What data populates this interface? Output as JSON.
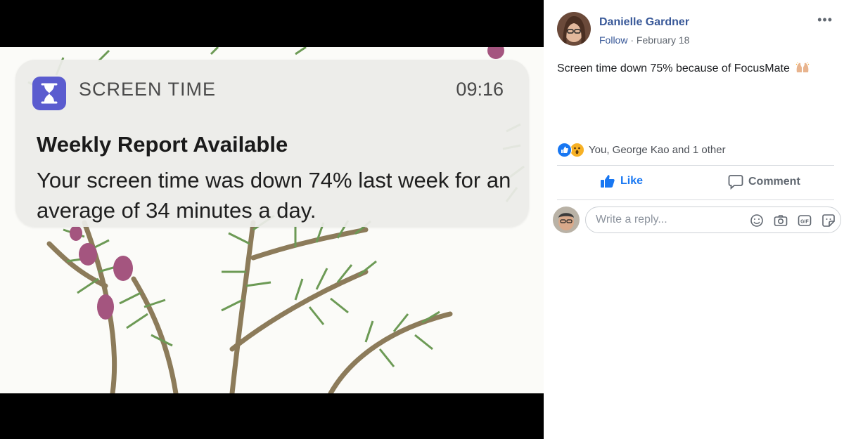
{
  "photo": {
    "notification": {
      "app_name": "SCREEN TIME",
      "time": "09:16",
      "title": "Weekly Report Available",
      "body": "Your screen time was down 74% last week for an average of 34 minutes a day.",
      "app_icon": "hourglass-icon",
      "icon_color": "#5b5ccf"
    }
  },
  "post": {
    "author": "Danielle Gardner",
    "follow": "Follow",
    "separator": " · ",
    "date": "February 18",
    "more_icon": "ellipsis-icon",
    "text": "Screen time down 75% because of FocusMate",
    "text_emoji": "raised-hands-emoji",
    "reactions": {
      "icons": [
        "like-reaction-icon",
        "wow-reaction-icon"
      ],
      "summary": "You, George Kao and 1 other"
    },
    "actions": {
      "like": "Like",
      "comment": "Comment"
    },
    "reply": {
      "placeholder": "Write a reply...",
      "icons": [
        "emoji-icon",
        "camera-icon",
        "gif-icon",
        "sticker-icon"
      ]
    }
  },
  "colors": {
    "link": "#385898",
    "like_blue": "#1877f2",
    "wow_yellow": "#f7b125"
  }
}
